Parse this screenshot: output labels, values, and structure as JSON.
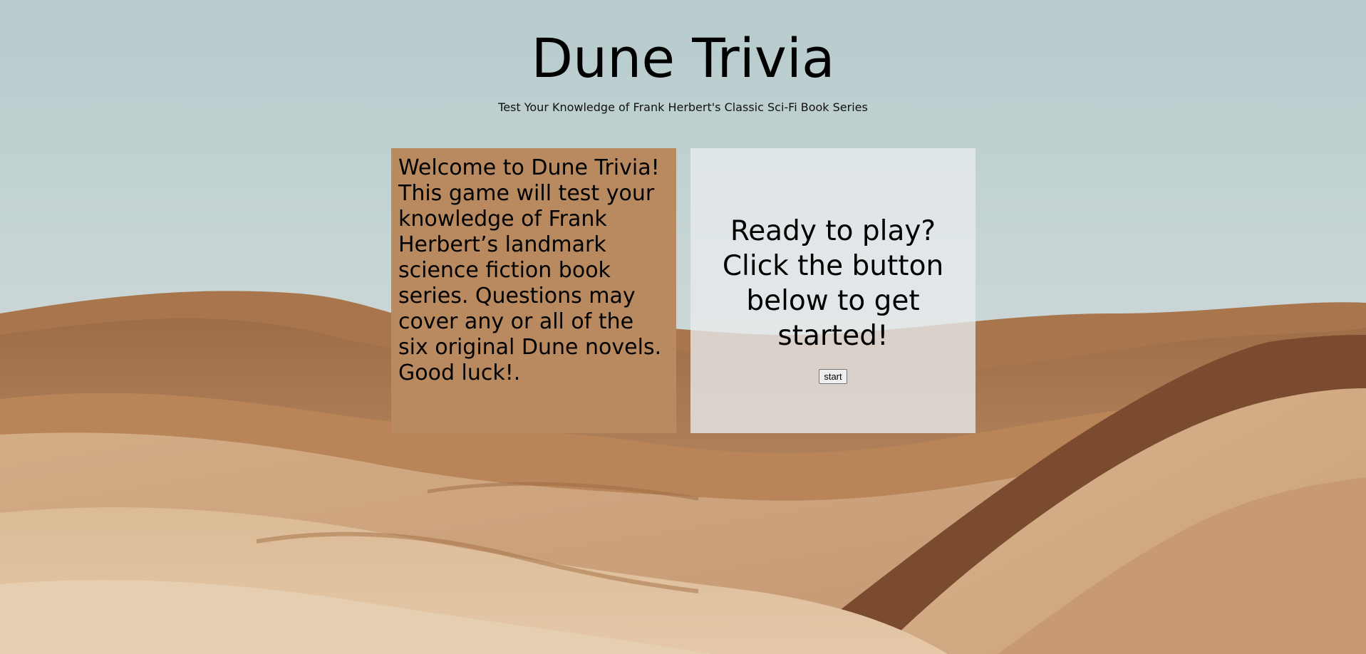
{
  "header": {
    "title": "Dune Trivia",
    "subtitle": "Test Your Knowledge of Frank Herbert's Classic Sci-Fi Book Series"
  },
  "intro_card": {
    "text": "Welcome to Dune Trivia! This game will test your knowledge of Frank Herbert’s landmark science fiction book series. Questions may cover any or all of the six original Dune novels. Good luck!.",
    "background_color": "#b98a60"
  },
  "start_card": {
    "heading": "Ready to play? Click the button below to get started!",
    "button_label": "start"
  },
  "background": {
    "image": "desert-dunes",
    "sky_color": "#c9d6d6",
    "sand_color": "#c89a6e"
  }
}
